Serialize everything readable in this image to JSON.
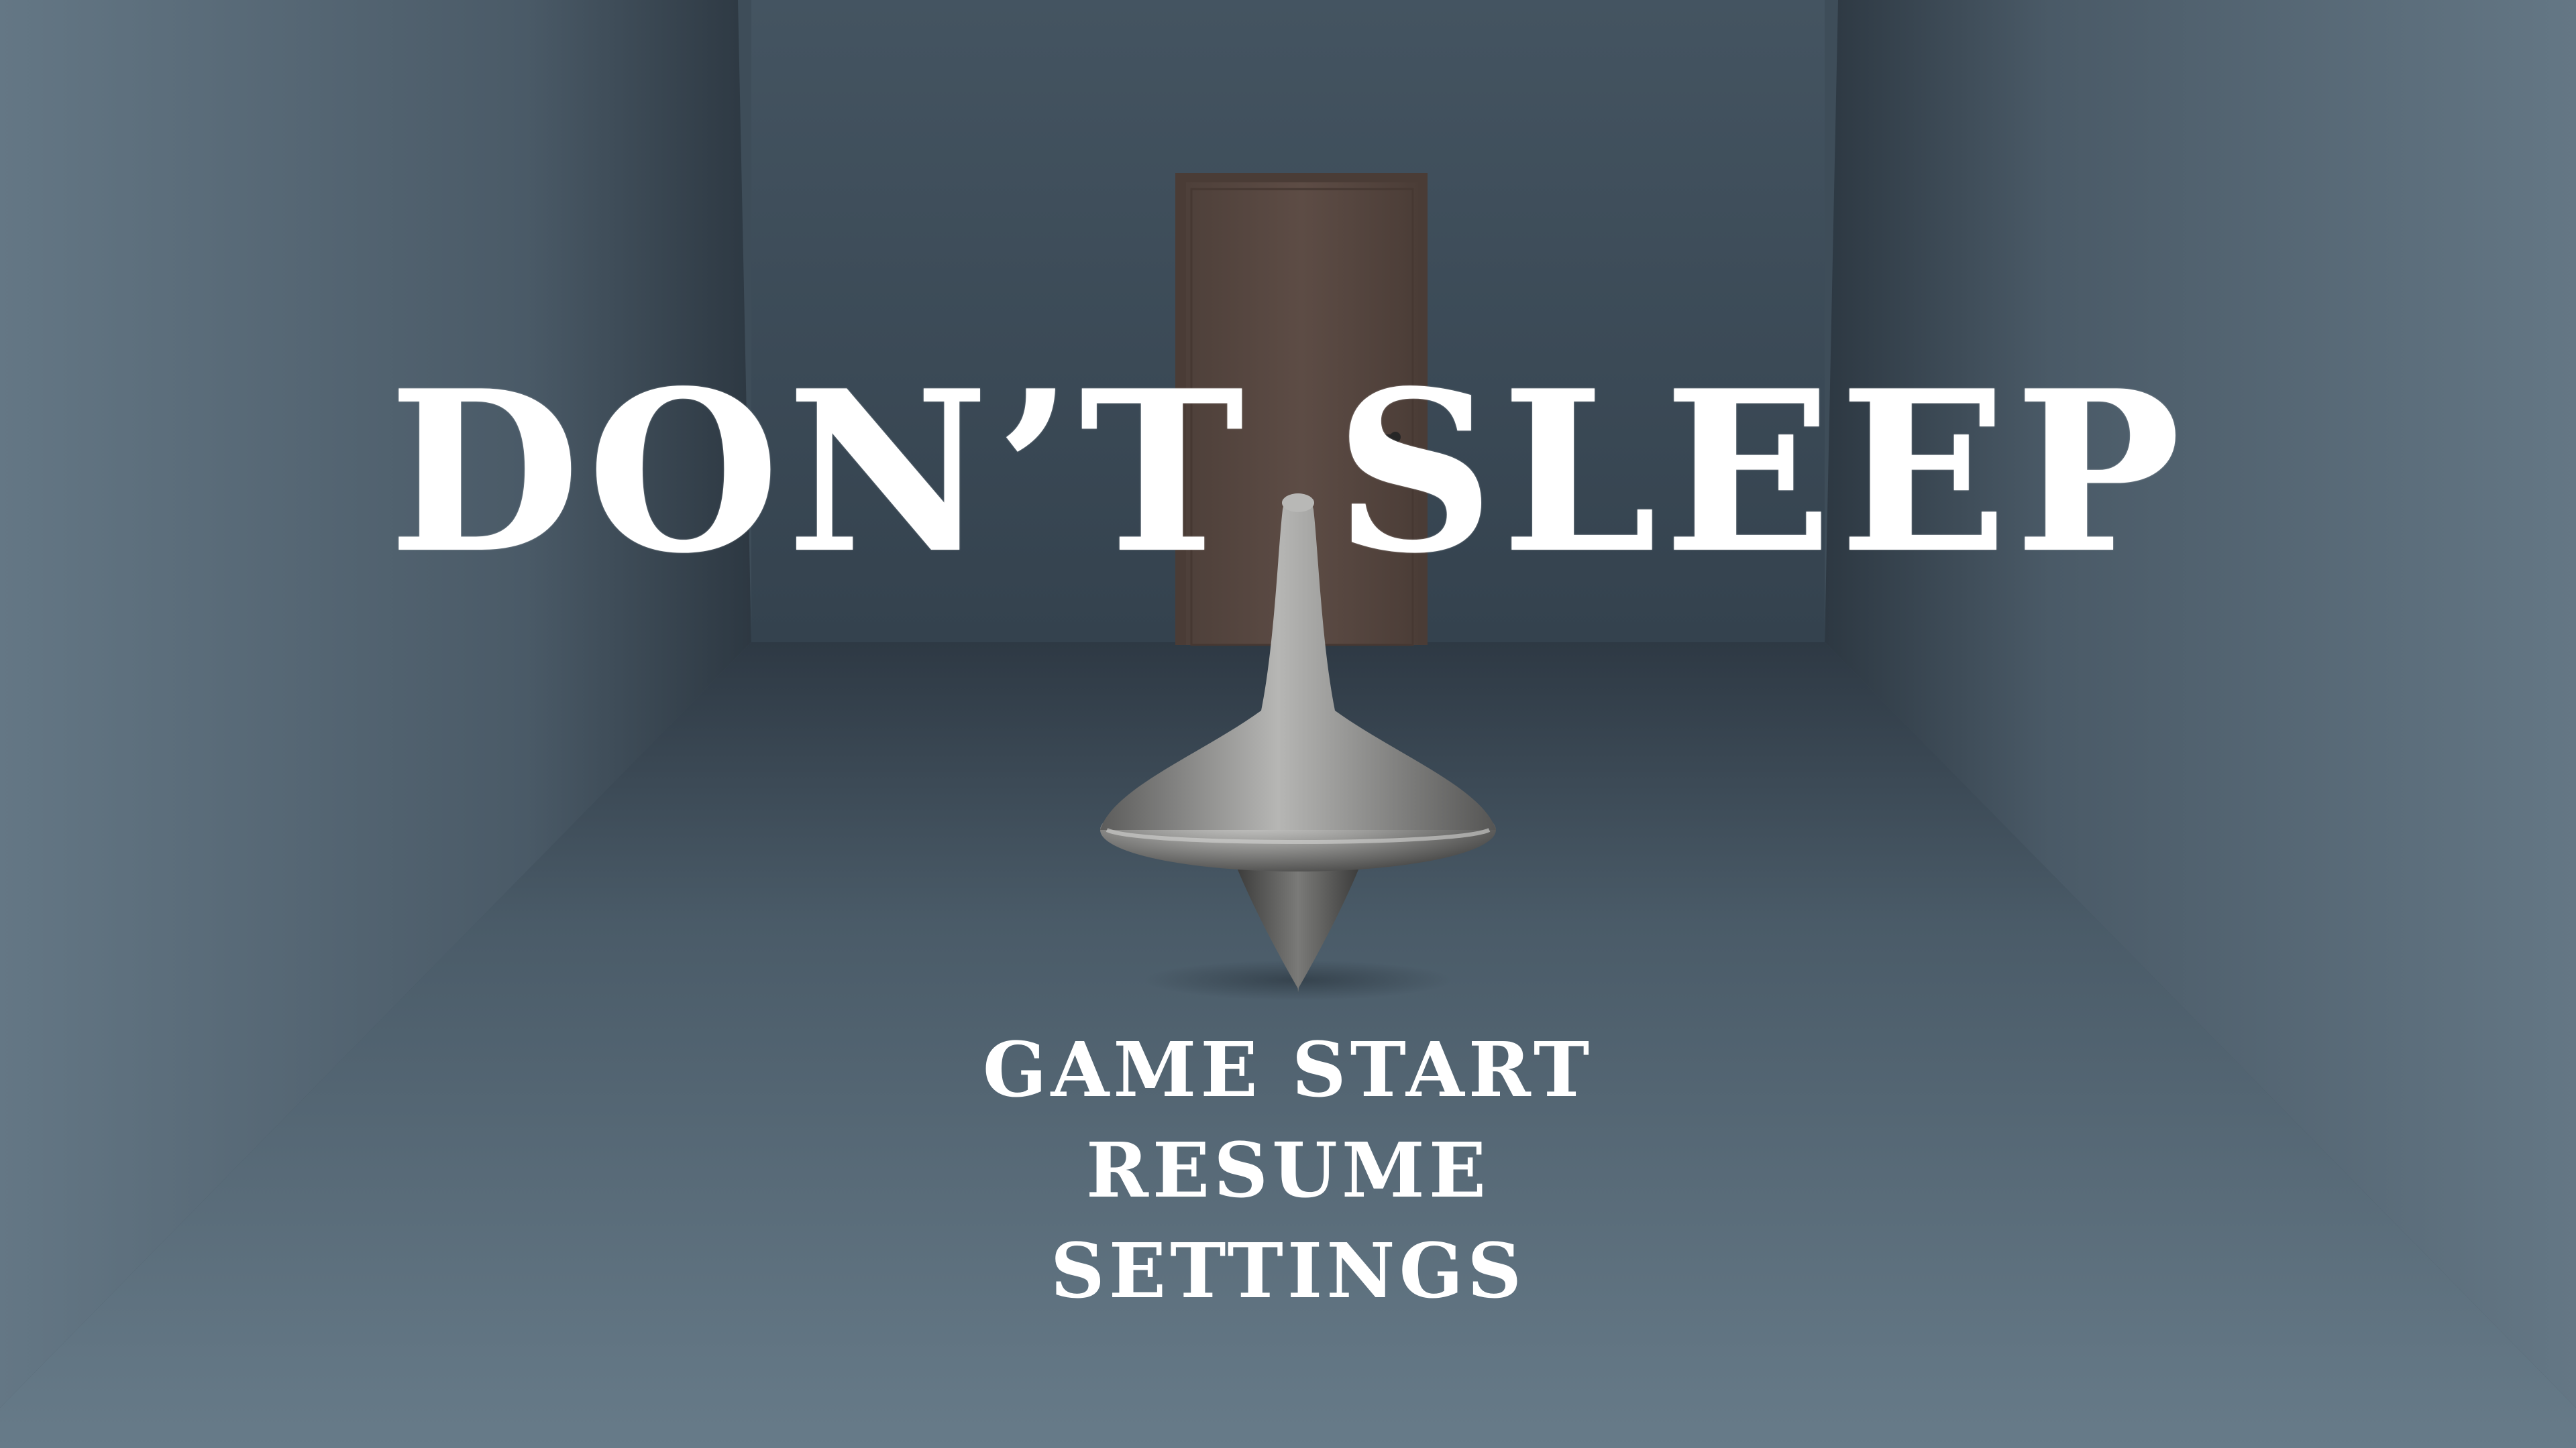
{
  "game": {
    "title": "DON’T SLEEP"
  },
  "menu": {
    "items": [
      {
        "label": "GAME START"
      },
      {
        "label": "RESUME"
      },
      {
        "label": "SETTINGS"
      }
    ]
  },
  "colors": {
    "back_wall": "#3b4b58",
    "floor": "#5e717f",
    "side_wall": "#4a5b68",
    "door": "#5b4b45",
    "text": "#ffffff"
  },
  "icons": {
    "spinning_top": "spinning-top-totem"
  }
}
